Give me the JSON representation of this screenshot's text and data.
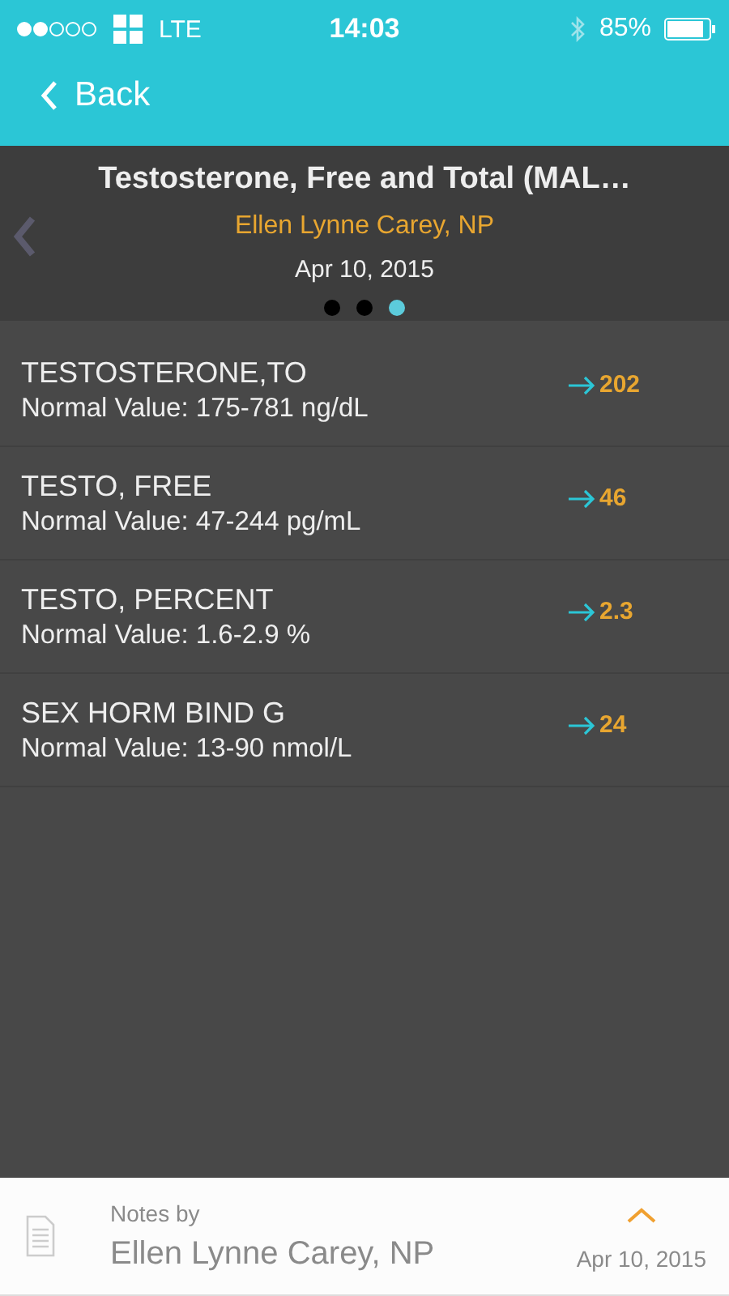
{
  "status_bar": {
    "carrier": "LTE",
    "time": "14:03",
    "battery": "85%"
  },
  "nav": {
    "back": "Back"
  },
  "header": {
    "title": "Testosterone, Free and Total (MAL…",
    "provider": "Ellen Lynne Carey, NP",
    "date": "Apr 10, 2015",
    "pages": [
      {
        "selected": false
      },
      {
        "selected": false
      },
      {
        "selected": true
      }
    ]
  },
  "results": [
    {
      "name": "TESTOSTERONE,TO",
      "normal": "Normal Value: 175-781 ng/dL",
      "value": "202"
    },
    {
      "name": "TESTO, FREE",
      "normal": "Normal Value: 47-244 pg/mL",
      "value": "46"
    },
    {
      "name": "TESTO, PERCENT",
      "normal": "Normal Value: 1.6-2.9 %",
      "value": "2.3"
    },
    {
      "name": "SEX HORM BIND G",
      "normal": "Normal Value: 13-90 nmol/L",
      "value": "24"
    }
  ],
  "notes": {
    "label": "Notes by",
    "author": "Ellen Lynne Carey, NP",
    "date": "Apr 10, 2015"
  }
}
